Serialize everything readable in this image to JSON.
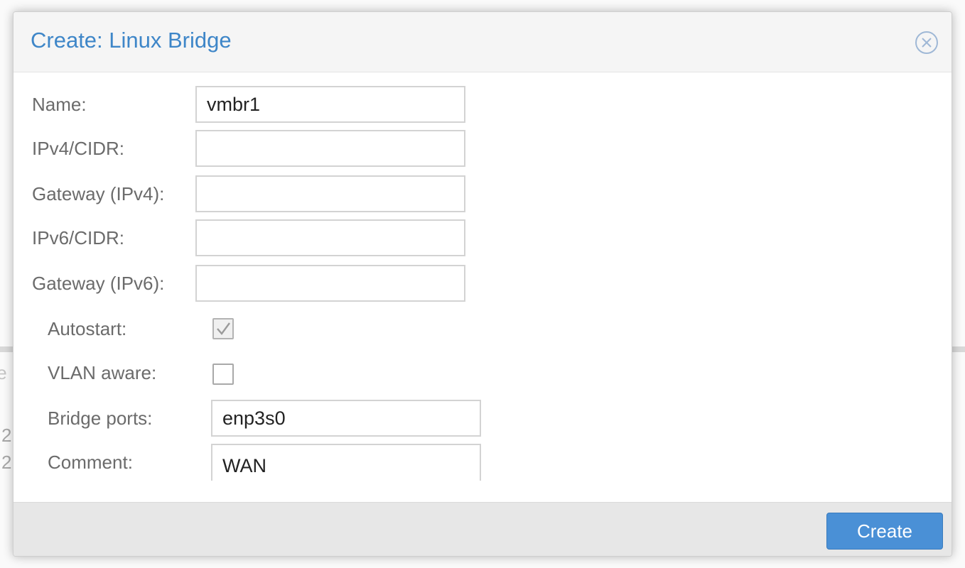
{
  "dialog": {
    "title": "Create: Linux Bridge"
  },
  "form": {
    "name": {
      "label": "Name:",
      "value": "vmbr1"
    },
    "ipv4_cidr": {
      "label": "IPv4/CIDR:",
      "value": ""
    },
    "gateway_ipv4": {
      "label": "Gateway (IPv4):",
      "value": ""
    },
    "ipv6_cidr": {
      "label": "IPv6/CIDR:",
      "value": ""
    },
    "gateway_ipv6": {
      "label": "Gateway (IPv6):",
      "value": ""
    },
    "autostart": {
      "label": "Autostart:",
      "checked": true
    },
    "vlan_aware": {
      "label": "VLAN aware:",
      "checked": false
    },
    "bridge_ports": {
      "label": "Bridge ports:",
      "value": "enp3s0"
    },
    "comment": {
      "label": "Comment:",
      "value": "WAN"
    }
  },
  "footer": {
    "create_label": "Create"
  },
  "background": {
    "fragment_a": "te",
    "fragment_b": "2",
    "fragment_c": "2"
  },
  "colors": {
    "title": "#3e86c8",
    "primary_button": "#4a90d6"
  },
  "icons": {
    "close": "close-circle-x-icon",
    "checkmark": "check-icon"
  }
}
